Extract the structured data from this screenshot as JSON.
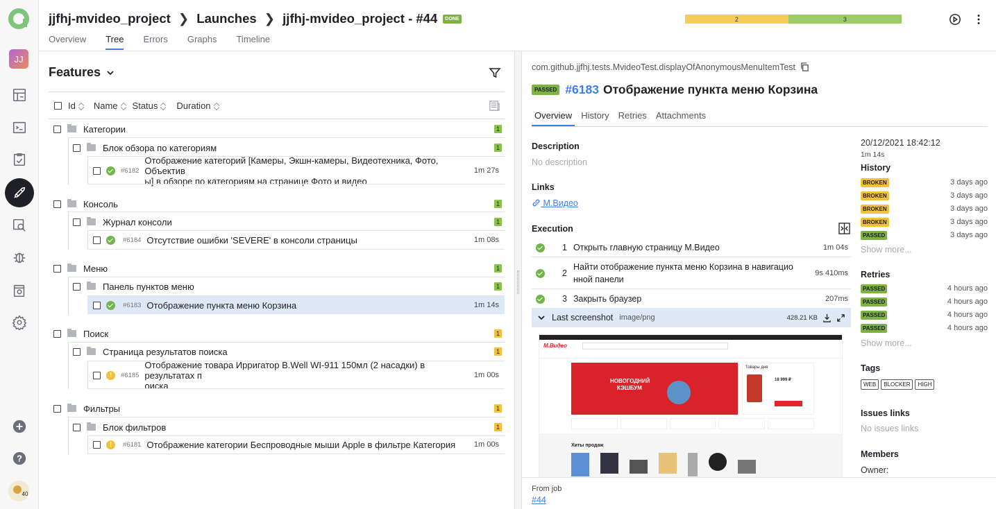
{
  "header": {
    "project": "jjfhj-mvideo_project",
    "launches": "Launches",
    "launch": "jjfhj-mvideo_project - #44",
    "status": "DONE",
    "bar": [
      {
        "label": "2",
        "fraction": 0.477,
        "color": "#f4cd5a"
      },
      {
        "label": "3",
        "fraction": 0.523,
        "color": "#9ccb67"
      }
    ],
    "tabs": [
      "Overview",
      "Tree",
      "Errors",
      "Graphs",
      "Timeline"
    ]
  },
  "sidebar": {
    "avatar": "JJ"
  },
  "tree": {
    "title": "Features",
    "columns": {
      "id": "Id",
      "name": "Name",
      "status": "Status",
      "duration": "Duration"
    },
    "groups": [
      {
        "name": "Категории",
        "count": "1",
        "sub": "Блок обзора по категориям",
        "subcount": "1",
        "test": {
          "id": "#6182",
          "name": "Отображение категорий [Камеры, Экшн-камеры, Видеотехника, Фото, Объективы] в обзоре по категориям на странице Фото и видео",
          "line1": "Отображение категорий [Камеры, Экшн-камеры, Видеотехника, Фото, Объектив",
          "line2": "ы] в обзоре по категориям на странице Фото и видео",
          "duration": "1m 27s"
        }
      },
      {
        "name": "Консоль",
        "count": "1",
        "sub": "Журнал консоли",
        "subcount": "1",
        "test": {
          "id": "#6184",
          "name": "Отсутствие ошибки 'SEVERE' в консоли страницы",
          "duration": "1m 08s"
        }
      },
      {
        "name": "Меню",
        "count": "1",
        "sub": "Панель пунктов меню",
        "subcount": "1",
        "test": {
          "id": "#6183",
          "name": "Отображение пункта меню Корзина",
          "duration": "1m 14s"
        }
      },
      {
        "name": "Поиск",
        "count": "1",
        "sub": "Страница результатов поиска",
        "subcount": "1",
        "test": {
          "id": "#6185",
          "line1": "Отображение товара Ирригатор B.Well WI-911 150мл (2 насадки) в результатах п",
          "line2": "оиска",
          "duration": "1m 00s"
        }
      },
      {
        "name": "Фильтры",
        "count": "1",
        "sub": "Блок фильтров",
        "subcount": "1",
        "test": {
          "id": "#6181",
          "name": "Отображение категории Беспроводные мыши Apple в фильтре Категория",
          "duration": "1m 00s"
        }
      }
    ]
  },
  "detail": {
    "path": "com.github.jjfhj.tests.MvideoTest.displayOfAnonymousMenuItemTest",
    "status": "PASSED",
    "id": "#6183",
    "title": "Отображение пункта меню Корзина",
    "tabs": [
      "Overview",
      "History",
      "Retries",
      "Attachments"
    ],
    "description_h": "Description",
    "description": "No description",
    "links_h": "Links",
    "link": "М.Видео",
    "execution_h": "Execution",
    "steps": [
      {
        "n": "1",
        "text": "Открыть главную страницу М.Видео",
        "duration": "1m 04s"
      },
      {
        "n": "2",
        "line1": "Найти отображение пункта меню Корзина в навигацио",
        "line2": "нной панели",
        "duration": "9s 410ms"
      },
      {
        "n": "3",
        "text": "Закрыть браузер",
        "duration": "207ms"
      }
    ],
    "attachment": {
      "name": "Last screenshot",
      "type": "image/png",
      "size": "428.21 KB"
    },
    "shot": {
      "banner1": "НОВОГОДНИЙ",
      "banner2": "КЭШБУМ",
      "section": "Хиты продаж",
      "goods": "Товары дня",
      "price": "18 999 ₽",
      "brand": "М.Видео"
    },
    "date": "20/12/2021 18:42:12",
    "duration": "1m 14s",
    "history_h": "History",
    "history": [
      {
        "status": "BROKEN",
        "ago": "3 days ago"
      },
      {
        "status": "BROKEN",
        "ago": "3 days ago"
      },
      {
        "status": "BROKEN",
        "ago": "3 days ago"
      },
      {
        "status": "BROKEN",
        "ago": "3 days ago"
      },
      {
        "status": "PASSED",
        "ago": "3 days ago"
      }
    ],
    "show_more": "Show more...",
    "retries_h": "Retries",
    "retries": [
      {
        "status": "PASSED",
        "ago": "4 hours ago"
      },
      {
        "status": "PASSED",
        "ago": "4 hours ago"
      },
      {
        "status": "PASSED",
        "ago": "4 hours ago"
      },
      {
        "status": "PASSED",
        "ago": "4 hours ago"
      }
    ],
    "tags_h": "Tags",
    "tags": [
      "WEB",
      "BLOCKER",
      "HIGH"
    ],
    "issues_h": "Issues links",
    "issues": "No issues links",
    "members_h": "Members",
    "owner": "Owner:",
    "from_job": "From job",
    "job": "#44"
  }
}
